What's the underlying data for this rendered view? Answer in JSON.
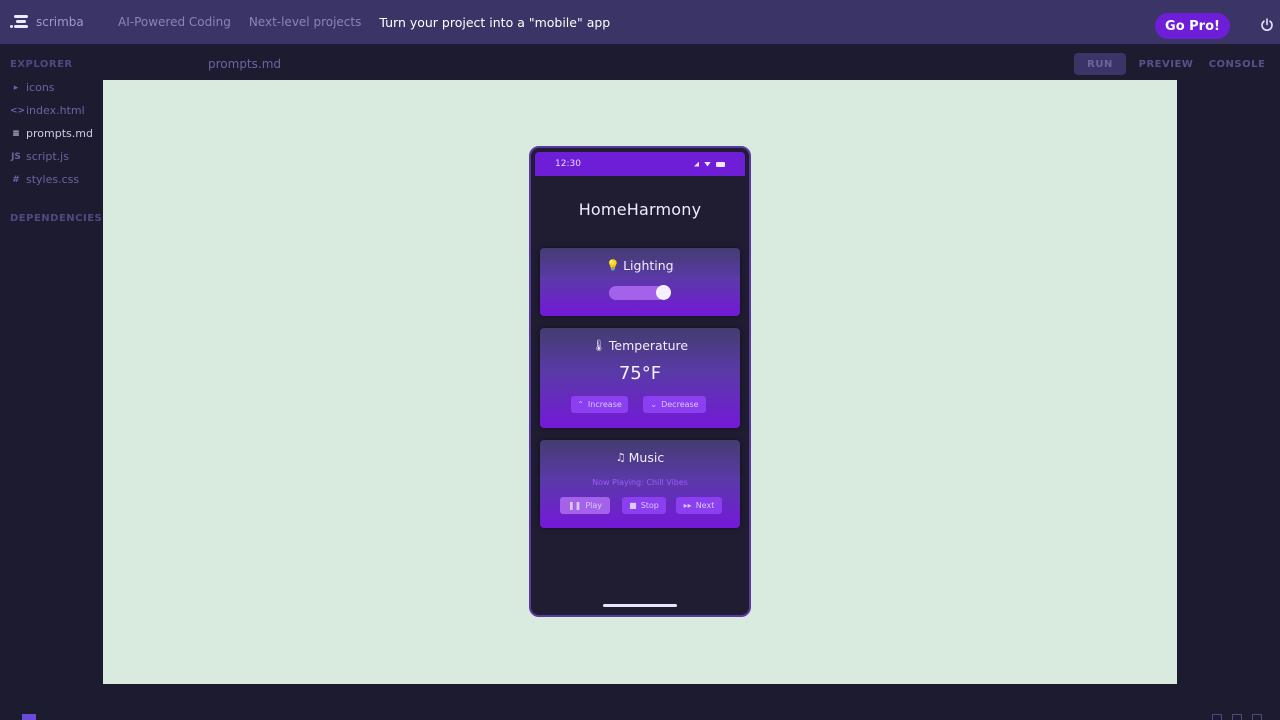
{
  "topbar": {
    "logo_text": "scrimba",
    "breadcrumbs": [
      "AI-Powered Coding",
      "Next-level projects",
      "Turn your project into a \"mobile\" app"
    ],
    "go_pro_label": "Go Pro!",
    "power_icon": "power-icon"
  },
  "sidebar": {
    "explorer_title": "EXPLORER",
    "files": [
      {
        "icon": "▸",
        "name": "icons",
        "icon_name": "folder-icon"
      },
      {
        "icon": "<>",
        "name": "index.html",
        "icon_name": "html-file-icon"
      },
      {
        "icon": "≡",
        "name": "prompts.md",
        "icon_name": "markdown-file-icon",
        "active": true
      },
      {
        "icon": "JS",
        "name": "script.js",
        "icon_name": "js-file-icon"
      },
      {
        "icon": "#",
        "name": "styles.css",
        "icon_name": "css-file-icon"
      }
    ],
    "dependencies_title": "DEPENDENCIES"
  },
  "editor": {
    "open_file": "prompts.md",
    "view_tabs": {
      "run": "RUN",
      "preview": "PREVIEW",
      "console": "CONSOLE"
    }
  },
  "phone": {
    "status_time": "12:30",
    "app_title": "HomeHarmony",
    "lighting": {
      "title": "Lighting",
      "icon": "💡",
      "toggle_on": true
    },
    "temperature": {
      "title": "Temperature",
      "icon": "🌡",
      "value": "75°F",
      "increase_label": "Increase",
      "decrease_label": "Decrease"
    },
    "music": {
      "title": "Music",
      "icon": "♫",
      "track": "Now Playing: Chill Vibes",
      "play_label": "Play",
      "stop_label": "Stop",
      "next_label": "Next"
    }
  },
  "colors": {
    "accent": "#6f1ed8",
    "preview_bg": "#d9ebdf",
    "app_bg": "#201d33",
    "topbar": "#3a3566"
  }
}
